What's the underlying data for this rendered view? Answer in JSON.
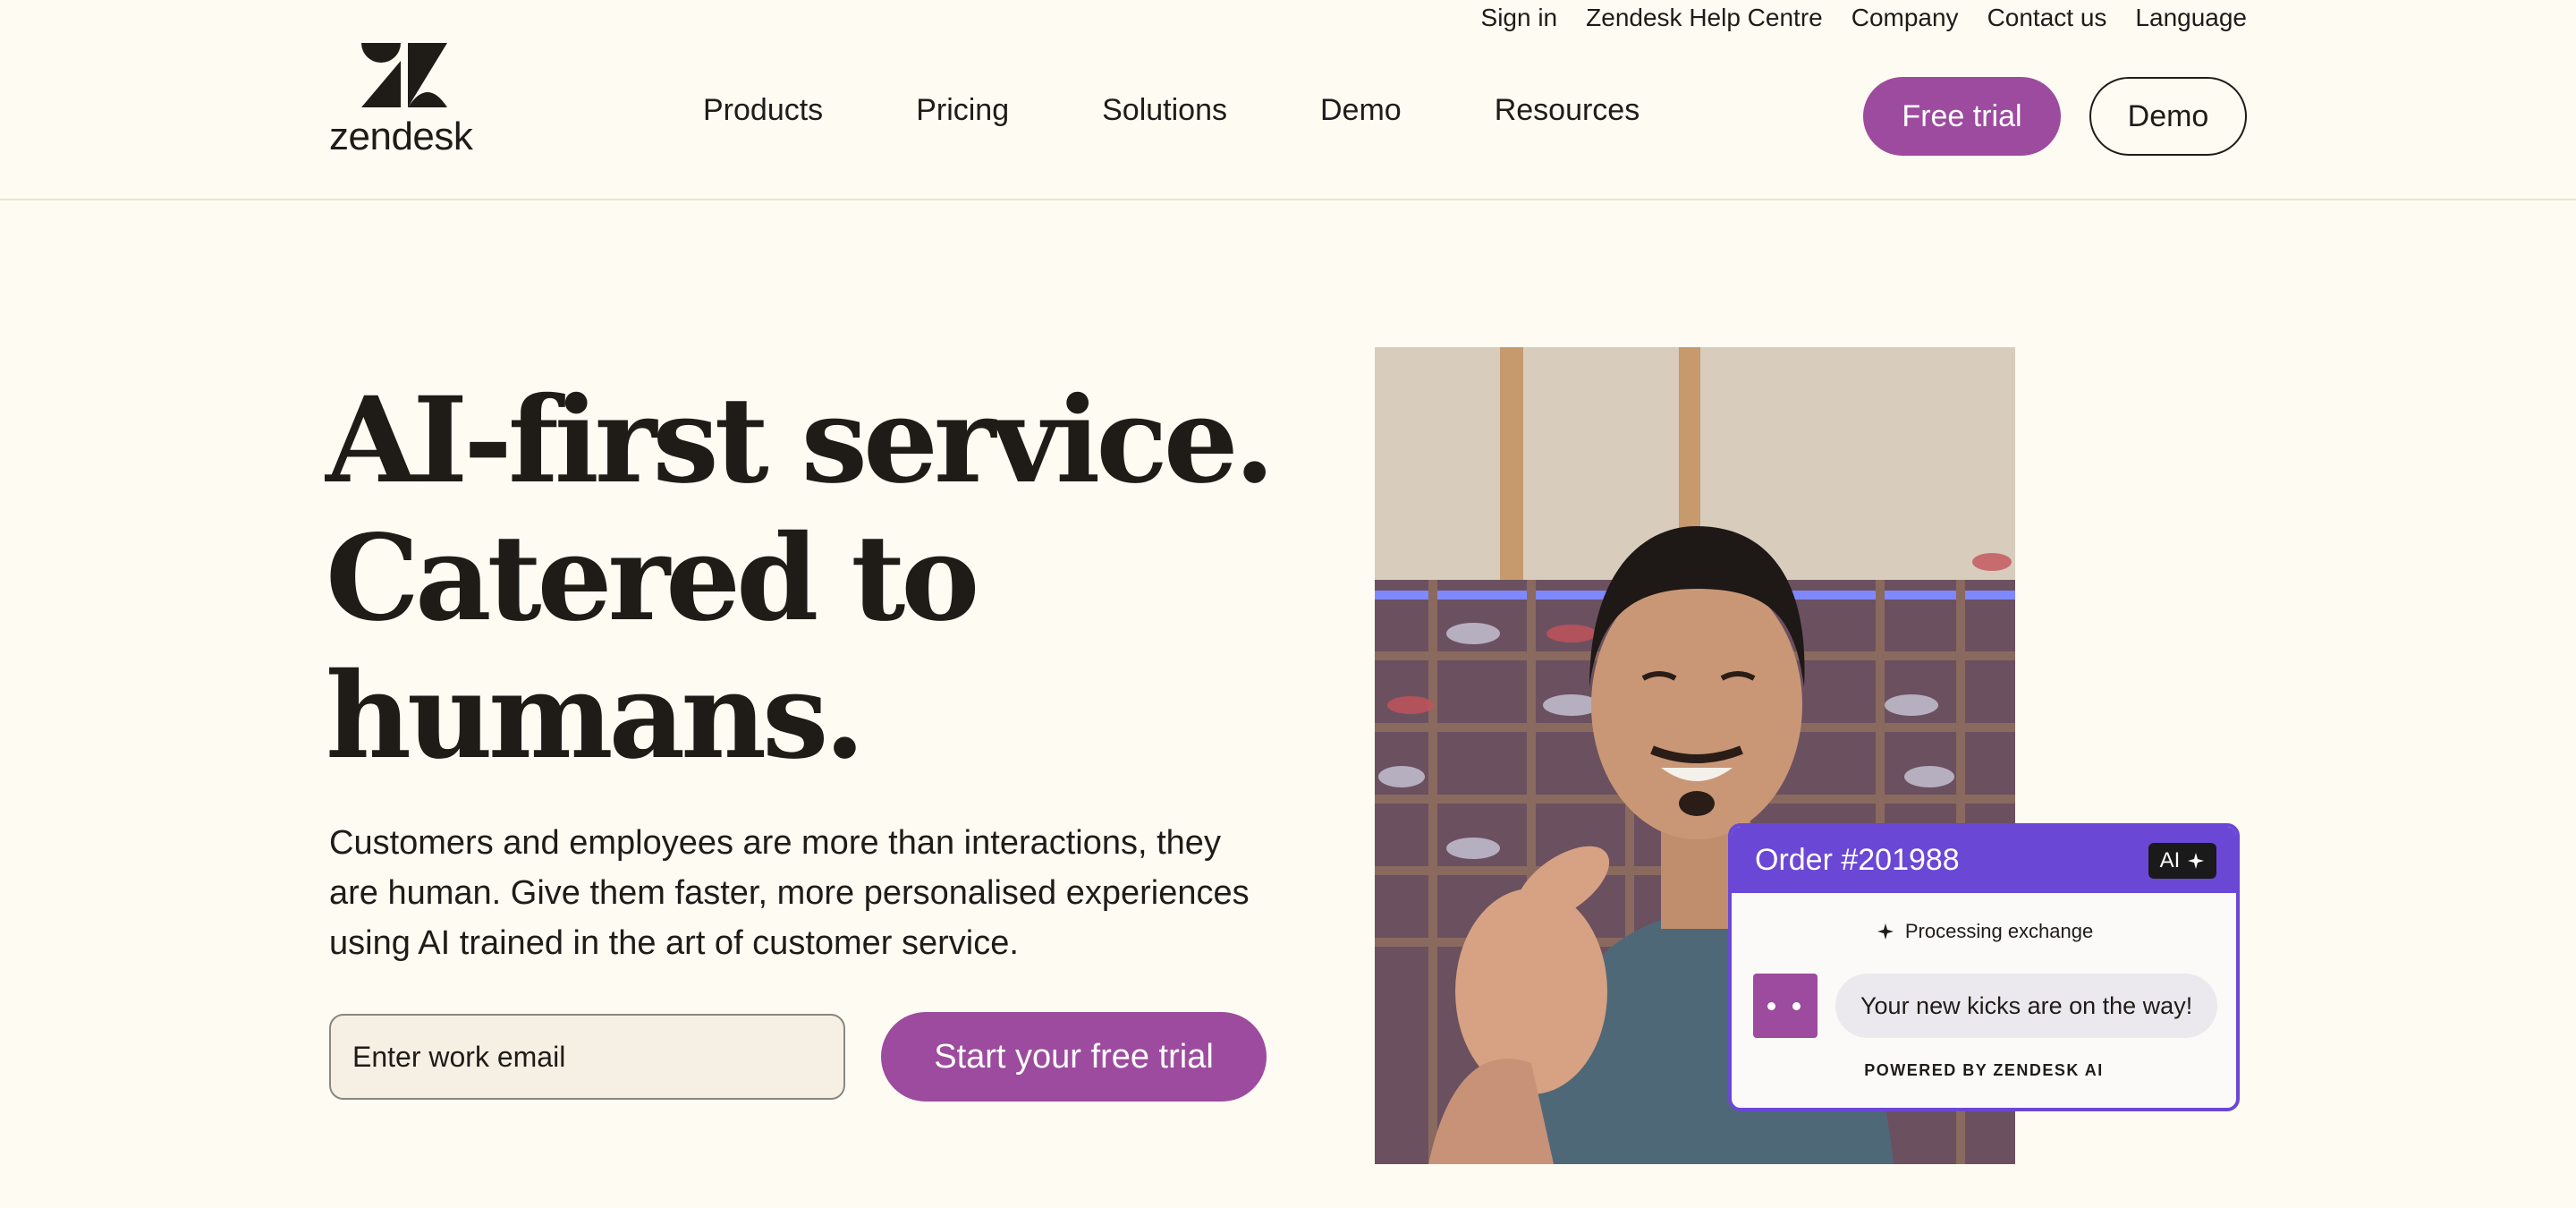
{
  "utility_nav": {
    "items": [
      "Sign in",
      "Zendesk Help Centre",
      "Company",
      "Contact us",
      "Language"
    ]
  },
  "brand": {
    "wordmark": "zendesk"
  },
  "nav": {
    "items": [
      "Products",
      "Pricing",
      "Solutions",
      "Demo",
      "Resources"
    ]
  },
  "header_actions": {
    "free_trial_label": "Free trial",
    "demo_label": "Demo"
  },
  "hero": {
    "headline_lines": [
      "AI-first service.",
      "Catered to",
      "humans."
    ],
    "subtext": "Customers and employees are more than interactions, they are human. Give them faster, more personalised experiences using AI trained in the art of customer service.",
    "email_placeholder": "Enter work email",
    "cta_label": "Start your free trial"
  },
  "ai_card": {
    "title": "Order #201988",
    "badge": "AI",
    "status": "Processing exchange",
    "message": "Your new kicks are on the way!",
    "footer": "POWERED BY ZENDESK AI"
  },
  "colors": {
    "background": "#fefbf3",
    "brand_purple": "#9d4b9e",
    "card_violet": "#6b47d6",
    "text": "#1f1c18"
  }
}
